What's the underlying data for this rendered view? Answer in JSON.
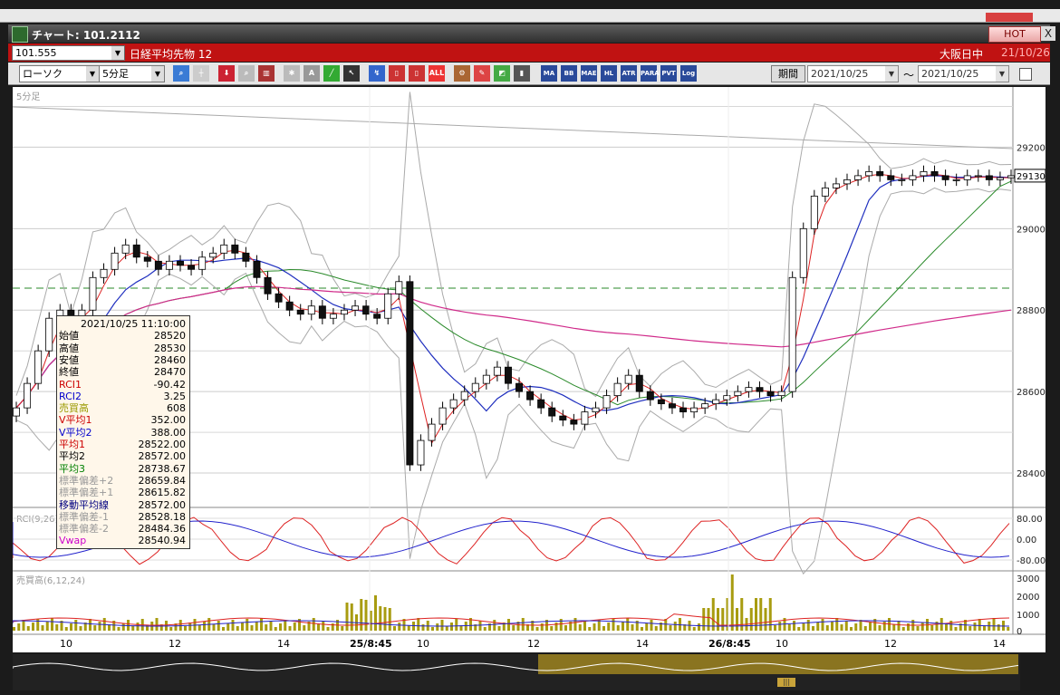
{
  "window": {
    "title": "チャート: 101.2112",
    "hot_label": "HOT",
    "close_label": "X"
  },
  "symbol_bar": {
    "code": "101.555",
    "name": "日経平均先物 12",
    "market": "大阪日中",
    "date": "21/10/26"
  },
  "toolbar": {
    "chart_type": "ローソク",
    "interval": "5分足",
    "tool_icons": [
      "zoom-icon",
      "crosshair-icon",
      "download-icon",
      "search-chart-icon",
      "compare-icon",
      "multi-chart-icon",
      "text-tool-icon",
      "draw-line-icon",
      "cursor-icon",
      "eraser-icon",
      "candle-a-icon",
      "candle-b-icon",
      "delete-all-icon",
      "settings-icon",
      "pen-icon",
      "color-icon",
      "candle-type-icon"
    ],
    "indicator_buttons": [
      "MA",
      "BB",
      "MAE",
      "HL",
      "ATR",
      "PARA",
      "PVT",
      "Log"
    ],
    "delete_all_label": "ALL",
    "period_label": "期間",
    "date_from": "2021/10/25",
    "date_to": "2021/10/25",
    "tilde": "〜"
  },
  "chart": {
    "timeframe_label": "5分足",
    "price_axis": [
      "29200",
      "29000",
      "28800",
      "28600",
      "28400"
    ],
    "current_price": "29130",
    "rci_label": "RCI(9,26)",
    "rci_axis": [
      "80.00",
      "0.00",
      "-80.00"
    ],
    "volume_label": "売買高(6,12,24)",
    "volume_axis": [
      "3000",
      "2000",
      "1000",
      "0"
    ],
    "time_axis": [
      "10",
      "12",
      "14",
      "25/8:45",
      "10",
      "12",
      "14",
      "26/8:45",
      "10",
      "12",
      "14"
    ]
  },
  "chart_data": {
    "type": "candlestick",
    "title": "",
    "y_range": [
      28320,
      29330
    ],
    "close_series": [
      28560,
      28620,
      28700,
      28780,
      28800,
      28740,
      28800,
      28880,
      28900,
      28940,
      28960,
      28930,
      28920,
      28900,
      28920,
      28910,
      28900,
      28930,
      28940,
      28960,
      28940,
      28920,
      28880,
      28840,
      28820,
      28800,
      28790,
      28810,
      28780,
      28790,
      28800,
      28810,
      28790,
      28780,
      28840,
      28870,
      28420,
      28480,
      28520,
      28560,
      28580,
      28600,
      28620,
      28640,
      28660,
      28620,
      28600,
      28580,
      28560,
      28540,
      28530,
      28520,
      28550,
      28560,
      28590,
      28620,
      28640,
      28600,
      28580,
      28570,
      28560,
      28550,
      28560,
      28570,
      28580,
      28590,
      28600,
      28610,
      28600,
      28590,
      28600,
      28880,
      29000,
      29080,
      29100,
      29110,
      29120,
      29130,
      29140,
      29130,
      29120,
      29120,
      29130,
      29140,
      29130,
      29120,
      29120,
      29130,
      29130,
      29120,
      29125,
      29130
    ]
  },
  "info_panel": {
    "rows": [
      {
        "label": "2021/10/25",
        "value": "11:10:00",
        "color": "#000000"
      },
      {
        "label": "始値",
        "value": "28520",
        "color": "#000000"
      },
      {
        "label": "高値",
        "value": "28530",
        "color": "#000000"
      },
      {
        "label": "安値",
        "value": "28460",
        "color": "#000000"
      },
      {
        "label": "終値",
        "value": "28470",
        "color": "#000000"
      },
      {
        "label": "RCI1",
        "value": "-90.42",
        "color": "#cc0000"
      },
      {
        "label": "RCI2",
        "value": "3.25",
        "color": "#0000cc"
      },
      {
        "label": "売買高",
        "value": "608",
        "color": "#9a9a00"
      },
      {
        "label": "V平均1",
        "value": "352.00",
        "color": "#cc0000"
      },
      {
        "label": "V平均2",
        "value": "388.00",
        "color": "#0000cc"
      },
      {
        "label": "平均1",
        "value": "28522.00",
        "color": "#cc0000"
      },
      {
        "label": "平均2",
        "value": "28572.00",
        "color": "#000000"
      },
      {
        "label": "平均3",
        "value": "28738.67",
        "color": "#008000"
      },
      {
        "label": "標準偏差+2",
        "value": "28659.84",
        "color": "#999999"
      },
      {
        "label": "標準偏差+1",
        "value": "28615.82",
        "color": "#999999"
      },
      {
        "label": "移動平均線",
        "value": "28572.00",
        "color": "#000080"
      },
      {
        "label": "標準偏差-1",
        "value": "28528.18",
        "color": "#999999"
      },
      {
        "label": "標準偏差-2",
        "value": "28484.36",
        "color": "#999999"
      },
      {
        "label": "Vwap",
        "value": "28540.94",
        "color": "#cc00cc"
      }
    ]
  }
}
